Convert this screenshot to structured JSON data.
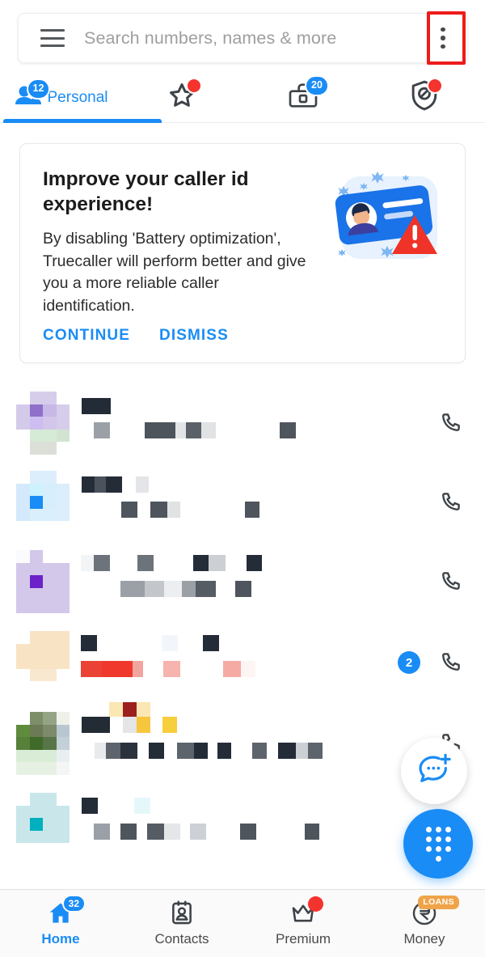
{
  "search": {
    "placeholder": "Search numbers, names & more",
    "menu_icon": "hamburger-menu-icon",
    "overflow_icon": "more-vertical-icon"
  },
  "tabs": [
    {
      "label": "Personal",
      "icon": "people-icon",
      "badge": "12",
      "badge_type": "number",
      "active": true
    },
    {
      "label": "",
      "icon": "star-icon",
      "badge": "",
      "badge_type": "dot",
      "active": false
    },
    {
      "label": "",
      "icon": "briefcase-icon",
      "badge": "20",
      "badge_type": "number",
      "active": false
    },
    {
      "label": "",
      "icon": "shield-block-icon",
      "badge": "",
      "badge_type": "dot",
      "active": false
    }
  ],
  "promo": {
    "title": "Improve your caller id experience!",
    "body": "By disabling 'Battery optimization', Truecaller will perform better and give you a more reliable caller identification.",
    "continue_label": "CONTINUE",
    "dismiss_label": "DISMISS",
    "illustration": "caller-id-card-warning-illustration"
  },
  "call_log": {
    "redacted": true,
    "note": "Call log entries are pixelated / censored in the screenshot",
    "rows": [
      {
        "avatar_tint": "#c9bfe3",
        "missed": false,
        "unread_count": "",
        "action_icon": "phone-icon"
      },
      {
        "avatar_tint": "#bfdcf7",
        "missed": false,
        "unread_count": "",
        "action_icon": "phone-icon"
      },
      {
        "avatar_tint": "#cec2ea",
        "missed": false,
        "unread_count": "",
        "action_icon": "phone-icon"
      },
      {
        "avatar_tint": "#f7dfbe",
        "missed": true,
        "unread_count": "2",
        "action_icon": "phone-icon"
      },
      {
        "avatar_tint": "#8ba868",
        "missed": false,
        "unread_count": "",
        "action_icon": "phone-icon"
      },
      {
        "avatar_tint": "#bfe3e6",
        "missed": false,
        "unread_count": "",
        "action_icon": "phone-icon"
      }
    ]
  },
  "fabs": {
    "message_icon": "new-message-icon",
    "dialpad_icon": "dialpad-icon"
  },
  "bottom_nav": [
    {
      "label": "Home",
      "icon": "home-icon",
      "badge": "32",
      "badge_type": "number",
      "active": true
    },
    {
      "label": "Contacts",
      "icon": "contacts-icon",
      "badge": "",
      "badge_type": "none",
      "active": false
    },
    {
      "label": "Premium",
      "icon": "crown-icon",
      "badge": "",
      "badge_type": "dot",
      "active": false
    },
    {
      "label": "Money",
      "icon": "rupee-icon",
      "badge": "LOANS",
      "badge_type": "pill",
      "active": false
    }
  ],
  "colors": {
    "accent_blue": "#1a8cf5",
    "alert_red": "#f4332e",
    "annotation_red": "#ee1b1b",
    "loans_orange": "#f0a44a"
  },
  "annotation": {
    "target": "overflow-menu-button",
    "shape": "red-rectangle"
  }
}
